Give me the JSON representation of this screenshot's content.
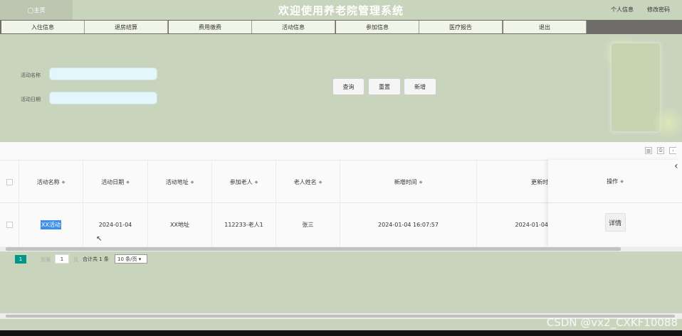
{
  "header": {
    "home_tab": "◯主页",
    "title": "欢迎使用养老院管理系统",
    "profile_link": "个人信息",
    "password_link": "修改密码"
  },
  "menu": [
    {
      "label": "入住信息"
    },
    {
      "label": "退房结算"
    },
    {
      "label": "费用缴费"
    },
    {
      "label": "活动信息"
    },
    {
      "label": "参加信息"
    },
    {
      "label": "医疗报告"
    },
    {
      "label": "退出"
    }
  ],
  "search": {
    "name_label": "活动名称",
    "name_value": "",
    "date_label": "活动日期",
    "date_value": "",
    "query_button": "查询",
    "reset_button": "重置",
    "add_button": "新增"
  },
  "table": {
    "columns": [
      "活动名称",
      "活动日期",
      "活动地址",
      "参加老人",
      "老人姓名",
      "新增时间",
      "更新时",
      "操作"
    ],
    "rows": [
      {
        "name": "XX活动",
        "date": "2024-01-04",
        "address": "XX地址",
        "participant": "112233-老人1",
        "elder_name": "张三",
        "created": "2024-01-04 16:07:57",
        "updated": "2024-01-04",
        "action": "详情"
      }
    ]
  },
  "pagination": {
    "current_page": "1",
    "goto_prefix": "到第",
    "goto_value": "1",
    "goto_suffix": "页",
    "total": "合计共 1 条",
    "page_size": "10 条/页 ▾"
  },
  "watermark": "CSDN @vx2_CXKF10088"
}
